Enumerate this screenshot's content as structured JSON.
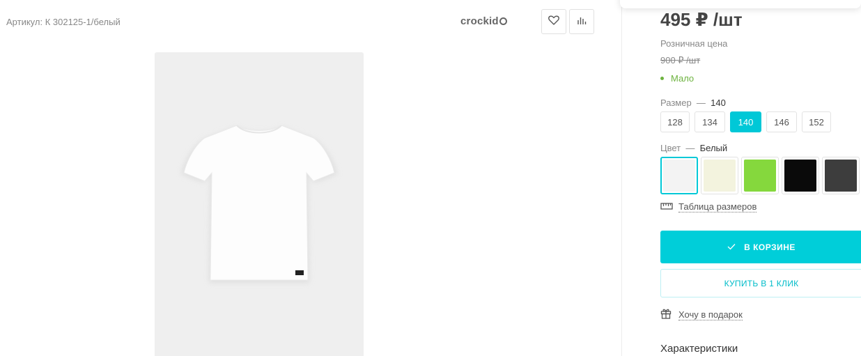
{
  "product": {
    "sku": "Артикул: К 302125-1/белый",
    "brand": "crockid"
  },
  "pricing": {
    "price": "495 ₽ /шт",
    "label": "Розничная цена",
    "old_price": "900 ₽ /шт",
    "stock": "Мало",
    "stock_color": "#6db33f"
  },
  "size": {
    "label": "Размер",
    "dash": "—",
    "selected": "140",
    "options": [
      "128",
      "134",
      "140",
      "146",
      "152"
    ]
  },
  "color": {
    "label": "Цвет",
    "dash": "—",
    "selected": "Белый",
    "swatches": [
      "#f3f3f3",
      "#f3f3de",
      "#85d83d",
      "#0a0a0a",
      "#3d3d3d"
    ]
  },
  "links": {
    "size_table": "Таблица размеров",
    "gift": "Хочу в подарок"
  },
  "buttons": {
    "in_cart": "В КОРЗИНЕ",
    "one_click": "КУПИТЬ В 1 КЛИК"
  },
  "characteristics": "Характеристики",
  "accent_color": "#00ced9"
}
